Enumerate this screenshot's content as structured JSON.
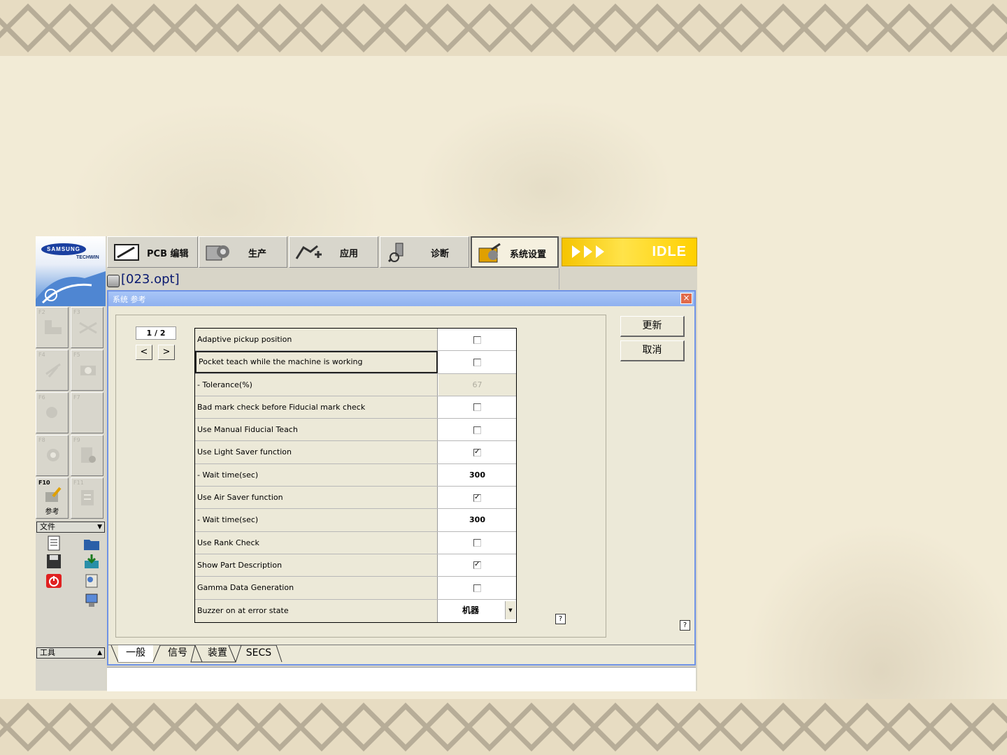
{
  "brand": {
    "logo_top": "SAMSUNG",
    "logo_bottom": "TECHWIN"
  },
  "file": {
    "name": "[023.opt]"
  },
  "top_tabs": [
    {
      "label": "PCB 编辑",
      "icon": "pcb-edit-icon"
    },
    {
      "label": "生产",
      "icon": "production-gear-icon"
    },
    {
      "label": "应用",
      "icon": "application-icon"
    },
    {
      "label": "诊断",
      "icon": "diagnosis-icon"
    },
    {
      "label": "系统设置",
      "icon": "system-settings-icon",
      "active": true
    }
  ],
  "status": {
    "state": "IDLE",
    "color": "#f5c400"
  },
  "fkeys": [
    {
      "label": "F2"
    },
    {
      "label": "F3"
    },
    {
      "label": "F4"
    },
    {
      "label": "F5"
    },
    {
      "label": "F6"
    },
    {
      "label": "F7"
    },
    {
      "label": "F8"
    },
    {
      "label": "F9"
    },
    {
      "label": "F10",
      "sub": "参考",
      "active": true
    },
    {
      "label": "F11"
    }
  ],
  "left_sections": {
    "file": "文件",
    "tools": "工具"
  },
  "dialog": {
    "title": "系统  参考",
    "close": "×",
    "pager": {
      "label": "1 / 2",
      "prev": "<",
      "next": ">"
    },
    "update_button": "更新",
    "cancel_button": "取消",
    "help": "?",
    "rows": [
      {
        "label": "Adaptive pickup position",
        "type": "checkbox",
        "checked": false
      },
      {
        "label": "Pocket teach while the machine is working",
        "type": "checkbox",
        "checked": false,
        "selected": true
      },
      {
        "label": " - Tolerance(%)",
        "type": "value",
        "value": "67",
        "disabled": true
      },
      {
        "label": "Bad mark check before Fiducial mark check",
        "type": "checkbox",
        "checked": false
      },
      {
        "label": "Use Manual Fiducial Teach",
        "type": "checkbox",
        "checked": false
      },
      {
        "label": "Use Light Saver function",
        "type": "checkbox",
        "checked": true
      },
      {
        "label": " - Wait time(sec)",
        "type": "value",
        "value": "300"
      },
      {
        "label": "Use Air Saver function",
        "type": "checkbox",
        "checked": true
      },
      {
        "label": " - Wait time(sec)",
        "type": "value",
        "value": "300"
      },
      {
        "label": "Use Rank Check",
        "type": "checkbox",
        "checked": false
      },
      {
        "label": "Show Part Description",
        "type": "checkbox",
        "checked": true
      },
      {
        "label": "Gamma Data Generation",
        "type": "checkbox",
        "checked": false
      },
      {
        "label": "Buzzer on at error state",
        "type": "dropdown",
        "value": "机器",
        "arrow": "▼"
      }
    ],
    "bottom_tabs": [
      {
        "label": "一般",
        "active": true
      },
      {
        "label": "信号"
      },
      {
        "label": "装置"
      },
      {
        "label": "SECS"
      }
    ]
  },
  "colors": {
    "dialog_border": "#6f93e6",
    "title_bar": "#a8c6f7",
    "close_button": "#e06a4a"
  }
}
